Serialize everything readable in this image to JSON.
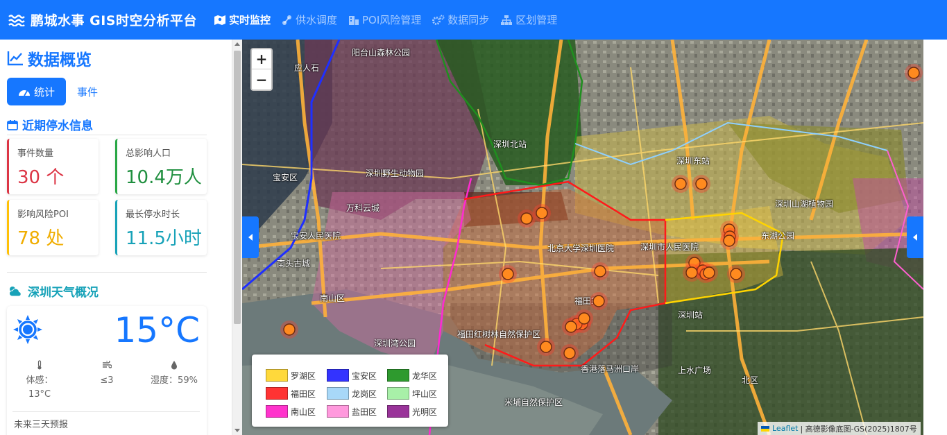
{
  "navbar": {
    "brand": "鹏城水事 GIS时空分析平台",
    "items": [
      {
        "label": "实时监控",
        "icon": "map-icon",
        "active": true
      },
      {
        "label": "供水调度",
        "icon": "network-icon",
        "active": false
      },
      {
        "label": "POI风险管理",
        "icon": "building-icon",
        "active": false
      },
      {
        "label": "数据同步",
        "icon": "cogs-icon",
        "active": false
      },
      {
        "label": "区划管理",
        "icon": "sitemap-icon",
        "active": false
      }
    ]
  },
  "sidebar": {
    "title": "数据概览",
    "tabs": [
      {
        "label": "统计",
        "active": true
      },
      {
        "label": "事件",
        "active": false
      }
    ],
    "outage": {
      "title": "近期停水信息",
      "cards": [
        {
          "label": "事件数量",
          "value": "30 个",
          "color": "#dc3545"
        },
        {
          "label": "总影响人口",
          "value": "10.4万人",
          "color": "#28a745"
        },
        {
          "label": "影响风险POI",
          "value": "78 处",
          "color": "#ffc107"
        },
        {
          "label": "最长停水时长",
          "value": "11.5小时",
          "color": "#17a2b8"
        }
      ]
    },
    "weather": {
      "title": "深圳天气概况",
      "temperature": "15°C",
      "feels_label": "体感：",
      "feels_value": "13°C",
      "wind": "≤3",
      "humidity": "湿度：59%",
      "forecast_title": "未来三天预报"
    }
  },
  "map": {
    "zoom_in": "+",
    "zoom_out": "−",
    "legend": [
      {
        "label": "罗湖区",
        "color": "#ffd93b"
      },
      {
        "label": "宝安区",
        "color": "#3333ff"
      },
      {
        "label": "龙华区",
        "color": "#2e9a2e"
      },
      {
        "label": "福田区",
        "color": "#ff3333"
      },
      {
        "label": "龙岗区",
        "color": "#a8d8f8"
      },
      {
        "label": "坪山区",
        "color": "#a8f0a8"
      },
      {
        "label": "南山区",
        "color": "#ff33cc"
      },
      {
        "label": "盐田区",
        "color": "#ff99dd"
      },
      {
        "label": "光明区",
        "color": "#993399"
      }
    ],
    "attribution_leaflet": "Leaflet",
    "attribution_text": "| 高德影像底图-GS(2025)1807号",
    "labels": [
      {
        "text": "阳台山森林公园"
      },
      {
        "text": "应人石"
      },
      {
        "text": "宝安区"
      },
      {
        "text": "深圳北站"
      },
      {
        "text": "深圳野生动物园"
      },
      {
        "text": "万科云城"
      },
      {
        "text": "宝安人民医院"
      },
      {
        "text": "南头古城"
      },
      {
        "text": "南山区"
      },
      {
        "text": "深圳湾公园"
      },
      {
        "text": "北京大学深圳医院"
      },
      {
        "text": "深圳市人民医院"
      },
      {
        "text": "福田站"
      },
      {
        "text": "深圳东站"
      },
      {
        "text": "东湖公园"
      },
      {
        "text": "深圳站"
      },
      {
        "text": "香港落马洲口岸"
      },
      {
        "text": "米埔自然保护区"
      },
      {
        "text": "上水广场"
      },
      {
        "text": "北区"
      },
      {
        "text": "深圳山湖植物园"
      },
      {
        "text": "福田红树林自然保护区"
      }
    ],
    "markers_count": 30
  }
}
